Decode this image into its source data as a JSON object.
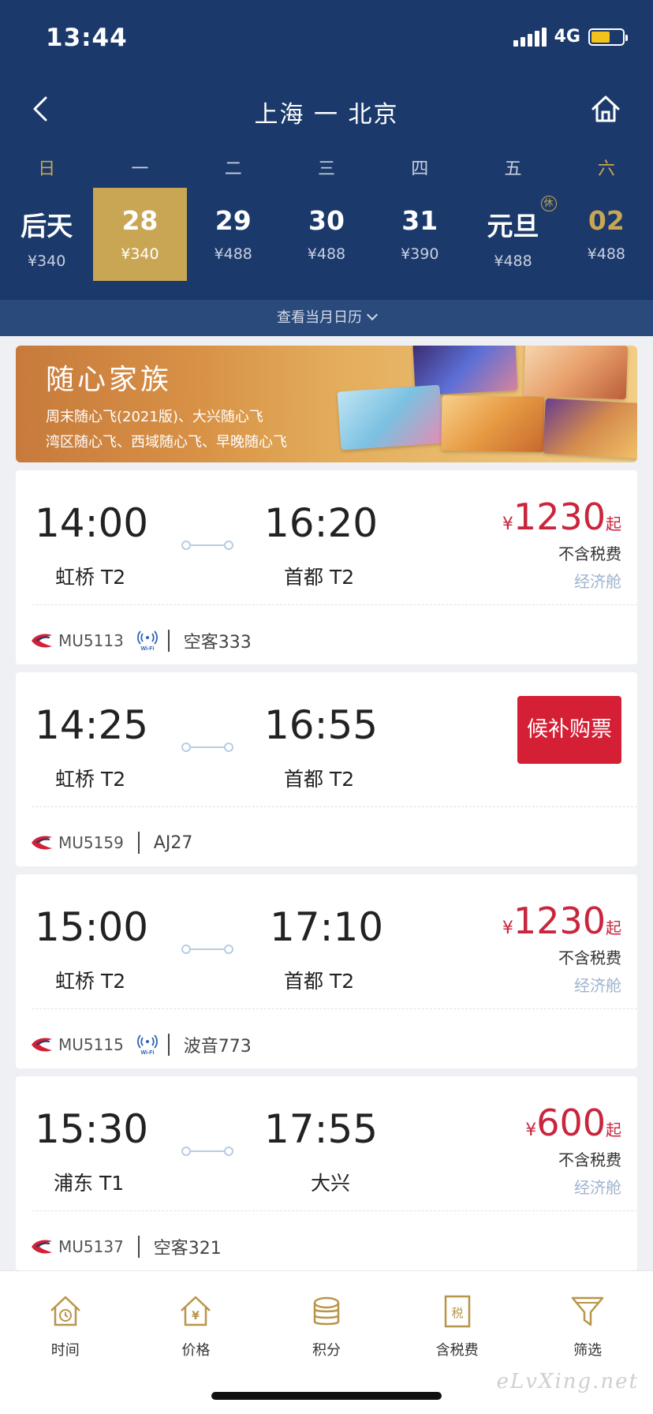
{
  "status_bar": {
    "time": "13:44",
    "network": "4G"
  },
  "header": {
    "route": "上海 一 北京"
  },
  "week_days": [
    "日",
    "一",
    "二",
    "三",
    "四",
    "五",
    "六"
  ],
  "dates": [
    {
      "day": "后天",
      "price": "¥340",
      "selected": false,
      "weekend": false
    },
    {
      "day": "28",
      "price": "¥340",
      "selected": true,
      "weekend": false
    },
    {
      "day": "29",
      "price": "¥488",
      "selected": false,
      "weekend": false
    },
    {
      "day": "30",
      "price": "¥488",
      "selected": false,
      "weekend": false
    },
    {
      "day": "31",
      "price": "¥390",
      "selected": false,
      "weekend": false
    },
    {
      "day": "元旦",
      "price": "¥488",
      "selected": false,
      "weekend": false,
      "badge": "休"
    },
    {
      "day": "02",
      "price": "¥488",
      "selected": false,
      "weekend": true
    }
  ],
  "month_calendar": "查看当月日历",
  "banner": {
    "title": "随心家族",
    "line1": "周末随心飞(2021版)、大兴随心飞",
    "line2": "湾区随心飞、西域随心飞、早晚随心飞"
  },
  "flights": [
    {
      "dep_time": "14:00",
      "arr_time": "16:20",
      "dep_airport": "虹桥 T2",
      "arr_airport": "首都 T2",
      "currency": "¥",
      "price": "1230",
      "price_suffix": "起",
      "tax_note": "不含税费",
      "cabin": "经济舱",
      "flight_no": "MU5113",
      "wifi": true,
      "plane": "空客333"
    },
    {
      "dep_time": "14:25",
      "arr_time": "16:55",
      "dep_airport": "虹桥 T2",
      "arr_airport": "首都 T2",
      "waitlist": "候补购票",
      "flight_no": "MU5159",
      "wifi": false,
      "plane": "AJ27"
    },
    {
      "dep_time": "15:00",
      "arr_time": "17:10",
      "dep_airport": "虹桥 T2",
      "arr_airport": "首都 T2",
      "currency": "¥",
      "price": "1230",
      "price_suffix": "起",
      "tax_note": "不含税费",
      "cabin": "经济舱",
      "flight_no": "MU5115",
      "wifi": true,
      "plane": "波音773"
    },
    {
      "dep_time": "15:30",
      "arr_time": "17:55",
      "dep_airport": "浦东 T1",
      "arr_airport": "大兴",
      "currency": "¥",
      "price": "600",
      "price_suffix": "起",
      "tax_note": "不含税费",
      "cabin": "经济舱",
      "flight_no": "MU5137",
      "wifi": false,
      "plane": "空客321"
    }
  ],
  "tabbar": [
    {
      "label": "时间",
      "icon": "time-icon"
    },
    {
      "label": "价格",
      "icon": "price-icon"
    },
    {
      "label": "积分",
      "icon": "points-icon"
    },
    {
      "label": "含税费",
      "icon": "tax-icon"
    },
    {
      "label": "筛选",
      "icon": "filter-icon"
    }
  ],
  "watermark": "eLvXing.net",
  "colors": {
    "header_bg": "#1b3a6b",
    "gold": "#c9a653",
    "price_red": "#c9253c",
    "waitlist_red": "#d41f35"
  }
}
